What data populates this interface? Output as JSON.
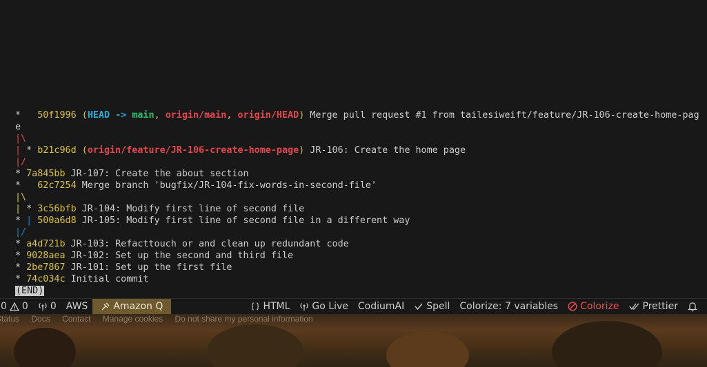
{
  "terminal": {
    "lines": [
      [
        {
          "t": "*   ",
          "c": "plain"
        },
        {
          "t": "50f1996",
          "c": "hash"
        },
        {
          "t": " (",
          "c": "paren"
        },
        {
          "t": "HEAD -> ",
          "c": "head"
        },
        {
          "t": "main",
          "c": "branch-main"
        },
        {
          "t": ", ",
          "c": "paren"
        },
        {
          "t": "origin/main",
          "c": "remote"
        },
        {
          "t": ", ",
          "c": "paren"
        },
        {
          "t": "origin/HEAD",
          "c": "remote"
        },
        {
          "t": ")",
          "c": "paren"
        },
        {
          "t": " Merge pull request #1 from tailesiweift/feature/JR-106-create-home-pag",
          "c": "plain"
        }
      ],
      [
        {
          "t": "e",
          "c": "plain"
        }
      ],
      [
        {
          "t": "|\\",
          "c": "g-red"
        }
      ],
      [
        {
          "t": "| ",
          "c": "g-red"
        },
        {
          "t": "* ",
          "c": "plain"
        },
        {
          "t": "b21c96d",
          "c": "hash"
        },
        {
          "t": " (",
          "c": "paren"
        },
        {
          "t": "origin/feature/JR-106-create-home-page",
          "c": "remote"
        },
        {
          "t": ")",
          "c": "paren"
        },
        {
          "t": " JR-106: Create the home page",
          "c": "plain"
        }
      ],
      [
        {
          "t": "|/",
          "c": "g-red"
        }
      ],
      [
        {
          "t": "* ",
          "c": "plain"
        },
        {
          "t": "7a845bb",
          "c": "hash"
        },
        {
          "t": " JR-107: Create the about section",
          "c": "plain"
        }
      ],
      [
        {
          "t": "*   ",
          "c": "plain"
        },
        {
          "t": "62c7254",
          "c": "hash"
        },
        {
          "t": " Merge branch 'bugfix/JR-104-fix-words-in-second-file'",
          "c": "plain"
        }
      ],
      [
        {
          "t": "|\\",
          "c": "g-yellow"
        }
      ],
      [
        {
          "t": "| ",
          "c": "g-yellow"
        },
        {
          "t": "* ",
          "c": "plain"
        },
        {
          "t": "3c56bfb",
          "c": "hash"
        },
        {
          "t": " JR-104: Modify first line of second file",
          "c": "plain"
        }
      ],
      [
        {
          "t": "* ",
          "c": "plain"
        },
        {
          "t": "| ",
          "c": "g-blue"
        },
        {
          "t": "500a6d8",
          "c": "hash"
        },
        {
          "t": " JR-105: Modify first line of second file in a different way",
          "c": "plain"
        }
      ],
      [
        {
          "t": "|/",
          "c": "g-blue"
        }
      ],
      [
        {
          "t": "* ",
          "c": "plain"
        },
        {
          "t": "a4d721b",
          "c": "hash"
        },
        {
          "t": " JR-103: Refacttouch or and clean up redundant code",
          "c": "plain"
        }
      ],
      [
        {
          "t": "* ",
          "c": "plain"
        },
        {
          "t": "9028aea",
          "c": "hash"
        },
        {
          "t": " JR-102: Set up the second and third file",
          "c": "plain"
        }
      ],
      [
        {
          "t": "* ",
          "c": "plain"
        },
        {
          "t": "2be7867",
          "c": "hash"
        },
        {
          "t": " JR-101: Set up the first file",
          "c": "plain"
        }
      ],
      [
        {
          "t": "* ",
          "c": "plain"
        },
        {
          "t": "74c034c",
          "c": "hash"
        },
        {
          "t": " Initial commit",
          "c": "plain"
        }
      ]
    ],
    "end_marker": "(END)"
  },
  "statusbar": {
    "errors": "0",
    "warnings": "0",
    "ports": "0",
    "aws": "AWS",
    "amazon_q": "Amazon Q",
    "language": "HTML",
    "go_live": "Go Live",
    "codium": "CodiumAI",
    "spell": "Spell",
    "colorize_vars": "Colorize: 7 variables",
    "colorize": "Colorize",
    "prettier": "Prettier"
  },
  "footer": {
    "links": [
      "Status",
      "Docs",
      "Contact",
      "Manage cookies",
      "Do not share my personal information"
    ]
  },
  "colors": {
    "hash": "#d8c24a",
    "head": "#2aa8d8",
    "main": "#2fbf71",
    "remote": "#e0474c",
    "amazon_q_bg": "#6e5a2e",
    "colorize_alert": "#f14c4c"
  }
}
